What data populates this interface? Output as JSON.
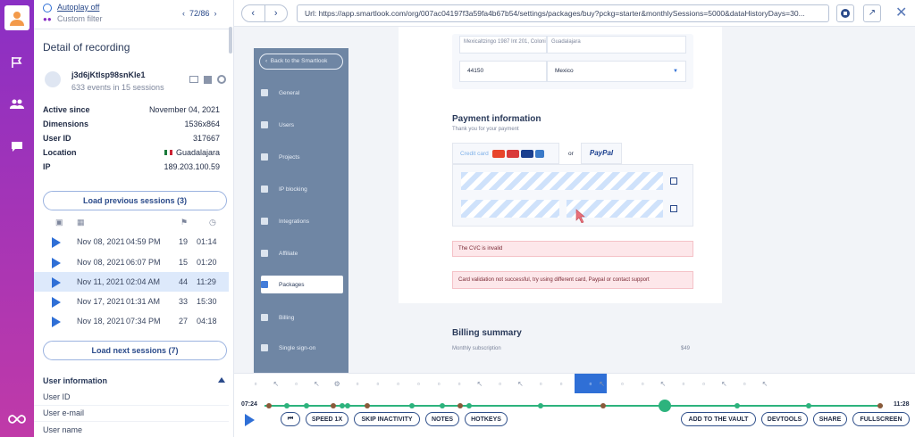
{
  "sidebar": {
    "autoplay": "Autoplay off",
    "filter": "Custom filter",
    "pager": "72/86",
    "detail_title": "Detail of recording",
    "user": {
      "id": "j3d6jKtlsp98snKle1",
      "summary": "633 events in 15 sessions"
    },
    "info": [
      {
        "label": "Active since",
        "value": "November 04, 2021"
      },
      {
        "label": "Dimensions",
        "value": "1536x864"
      },
      {
        "label": "User ID",
        "value": "317667"
      },
      {
        "label": "Location",
        "value": "Guadalajara"
      },
      {
        "label": "IP",
        "value": "189.203.100.59"
      }
    ],
    "load_prev": "Load previous sessions (3)",
    "load_next": "Load next sessions (7)",
    "sessions": [
      {
        "date": "Nov 08, 2021",
        "time": "04:59 PM",
        "events": "19",
        "duration": "01:14"
      },
      {
        "date": "Nov 08, 2021",
        "time": "06:07 PM",
        "events": "15",
        "duration": "01:20"
      },
      {
        "date": "Nov 11, 2021",
        "time": "02:04 AM",
        "events": "44",
        "duration": "11:29"
      },
      {
        "date": "Nov 17, 2021",
        "time": "01:31 AM",
        "events": "33",
        "duration": "15:30"
      },
      {
        "date": "Nov 18, 2021",
        "time": "07:34 PM",
        "events": "27",
        "duration": "04:18"
      }
    ],
    "user_info_title": "User information",
    "user_info": [
      "User ID",
      "User e-mail",
      "User name"
    ]
  },
  "browser": {
    "url": "Url: https://app.smartlook.com/org/007ac04197f3a59fa4b67b54/settings/packages/buy?pckg=starter&monthlySessions=5000&dataHistoryDays=30..."
  },
  "app": {
    "back": "Back to the Smartlook",
    "nav": [
      "General",
      "Users",
      "Projects",
      "IP blocking",
      "Integrations",
      "Affiliate",
      "Packages",
      "Billing",
      "Single sign-on"
    ],
    "active_nav": "Packages",
    "address_line": "Mexicaltzingo 1987 Int 201, Colonia Ba",
    "address_city": "Guadalajara",
    "zip": "44150",
    "country": "Mexico",
    "payment_title": "Payment information",
    "payment_sub": "Thank you for your payment",
    "credit_card": "Credit card",
    "or": "or",
    "paypal": "PayPal",
    "error_cvc": "The CVC is invalid",
    "error_card": "Card validation not successful, try using different card, Paypal or contact support",
    "billing_title": "Billing summary",
    "billing_line": "Monthly subscription",
    "billing_amount": "$49"
  },
  "player": {
    "time_start": "07:24",
    "time_end": "11:28",
    "buttons": {
      "speed": "SPEED 1X",
      "skip": "SKIP INACTIVITY",
      "notes": "NOTES",
      "hotkeys": "HOTKEYS",
      "vault": "ADD TO THE VAULT",
      "devtools": "DEVTOOLS",
      "share": "SHARE",
      "fullscreen": "FULLSCREEN"
    }
  },
  "colors": {
    "accent": "#2f6fd6",
    "rail": "#8a2fc4",
    "timeline": "#2db37d"
  }
}
